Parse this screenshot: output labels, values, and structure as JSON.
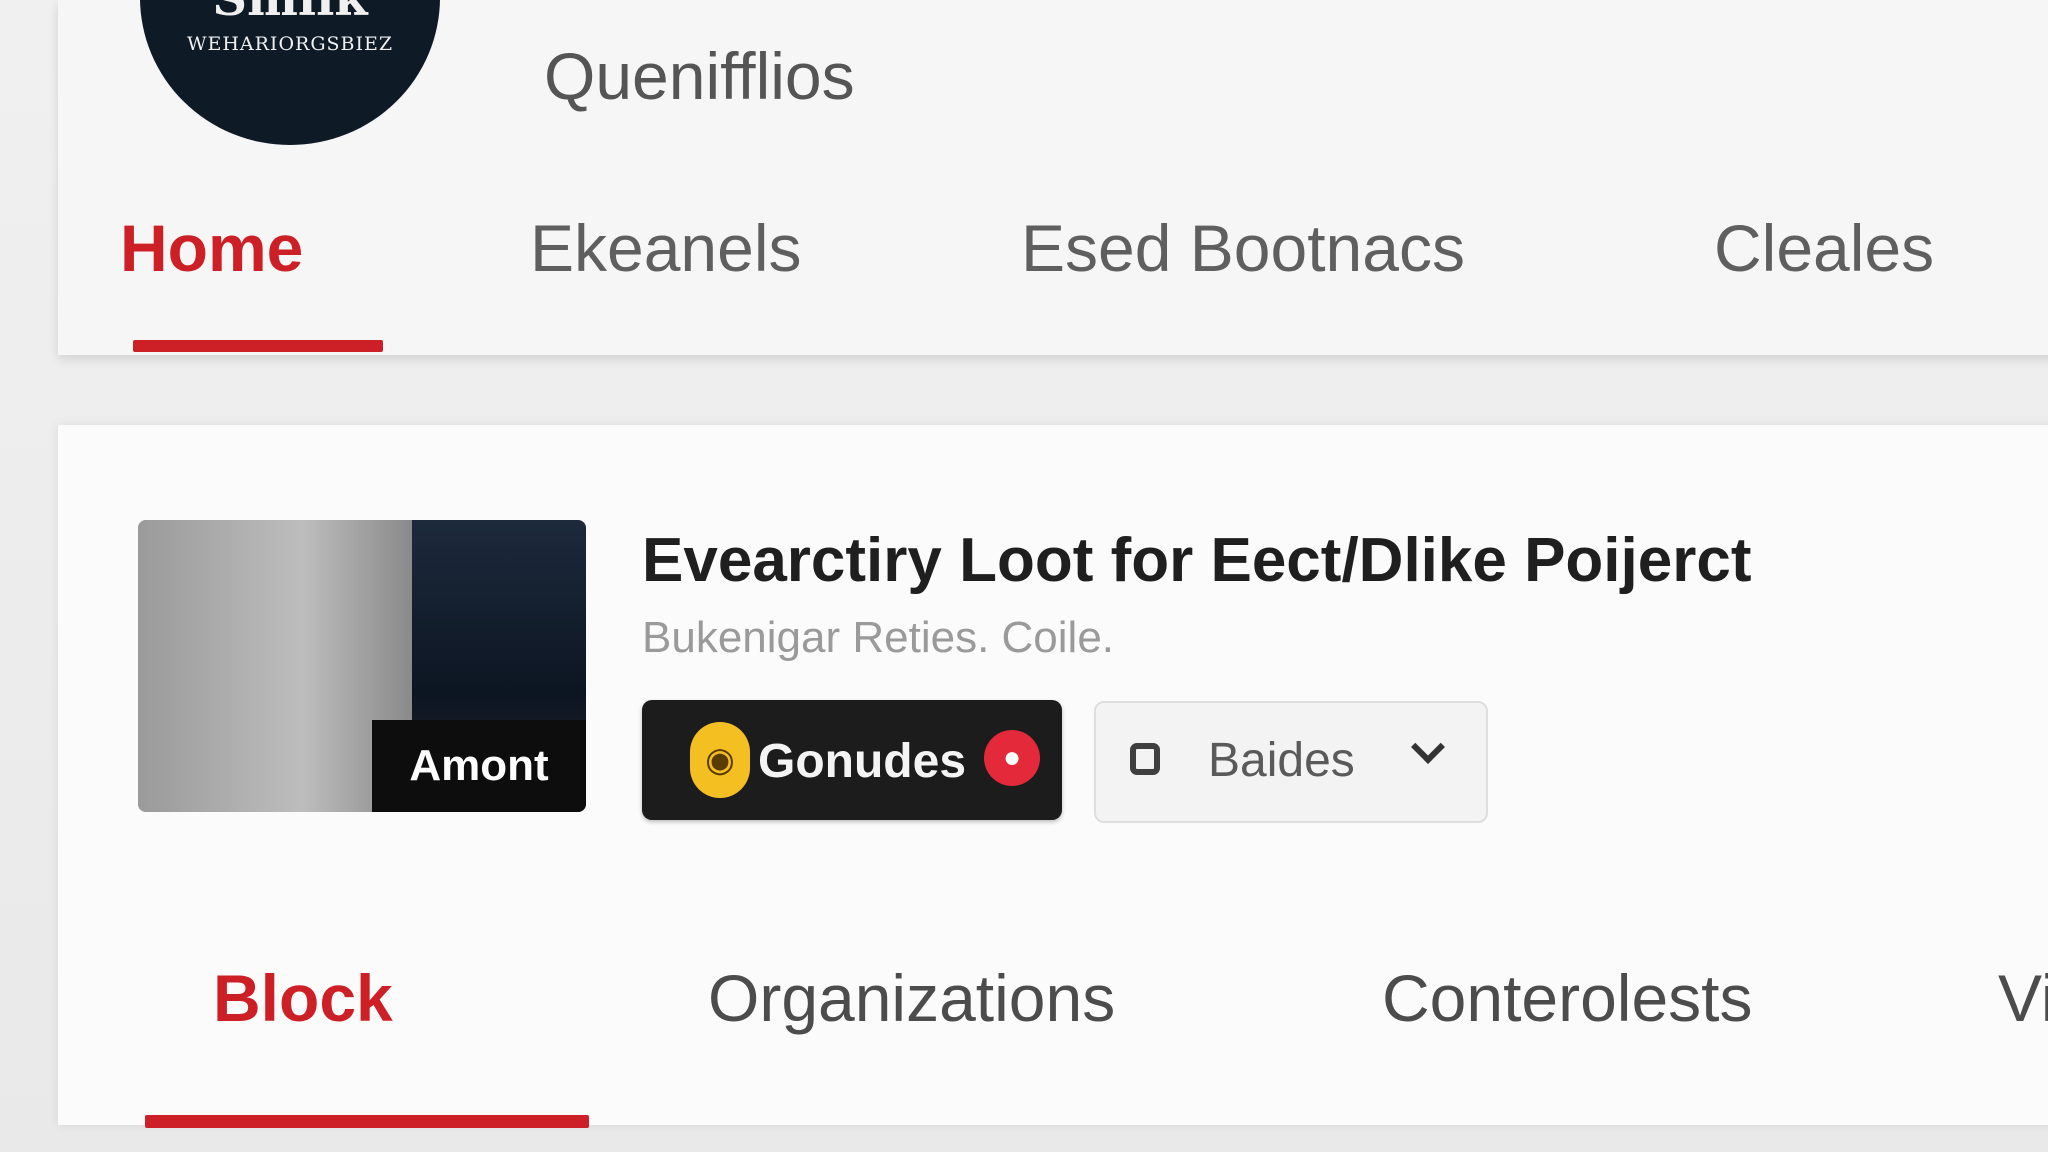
{
  "channel": {
    "avatar_main_text": "Smlik",
    "avatar_sub_text": "WEHARIORGSBIEZ",
    "name": "Quenifflios"
  },
  "header_tabs": [
    {
      "label": "Home",
      "active": true
    },
    {
      "label": "Ekeanels",
      "active": false
    },
    {
      "label": "Esed Bootnacs",
      "active": false
    },
    {
      "label": "Cleales",
      "active": false
    }
  ],
  "video": {
    "thumbnail_label": "Amont",
    "title": "Evearctiry Loot for Eect/Dlike Poijerct",
    "subtitle": "Bukenigar Reties. Coile.",
    "primary_button": {
      "label": "Gonudes",
      "icon": "coin-icon",
      "badge_icon": "pin-icon"
    },
    "secondary_button": {
      "label": "Baides",
      "icon": "square-icon",
      "chevron_icon": "chevron-down-icon"
    }
  },
  "content_tabs": [
    {
      "label": "Block",
      "active": true
    },
    {
      "label": "Organizations",
      "active": false
    },
    {
      "label": "Conterolests",
      "active": false
    },
    {
      "label": "Vi",
      "active": false
    }
  ],
  "colors": {
    "accent": "#cc2026",
    "avatar_bg": "#0f1a27",
    "button_dark": "#1c1c1c",
    "coin": "#f4c021",
    "badge": "#e42a3a"
  }
}
